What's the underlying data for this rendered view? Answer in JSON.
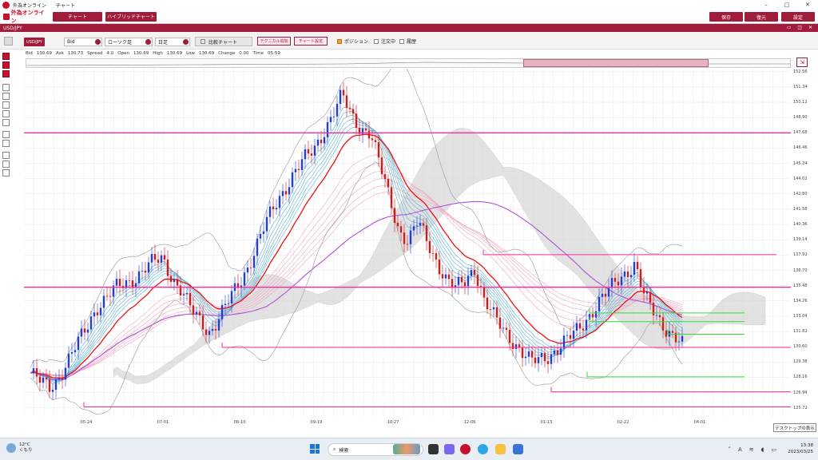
{
  "window": {
    "title_app": "外為オンライン",
    "title_page": "チャート"
  },
  "menubar": {
    "brand": "外為オンライン",
    "chart_button": "チャート",
    "hybrid_button": "ハイブリッドチャート",
    "save_button": "保存",
    "restore_button": "復元",
    "settings_button": "設定"
  },
  "panel": {
    "title": "USD/JPY"
  },
  "toolbar": {
    "symbol": "USD/JPY",
    "price_type": "Bid",
    "chart_type": "ローソク足",
    "timeframe": "日足",
    "compare_chart": "比較チャート",
    "add_technical": "テクニカル追加",
    "chart_settings": "チャート設定",
    "position_label": "ポジション",
    "position_checked": true,
    "ordering_label": "注文中",
    "history_label": "履歴"
  },
  "quote": {
    "bid_label": "Bid",
    "bid": "130.69",
    "ask_label": "Ask",
    "ask": "130.73",
    "spread_label": "Spread",
    "spread": "4.0",
    "open_label": "Open",
    "open": "130.69",
    "high_label": "High",
    "high": "130.69",
    "low_label": "Low",
    "low": "130.69",
    "change_label": "Change",
    "change": "0.00",
    "time_label": "Time",
    "time": "05:59"
  },
  "chart_data": {
    "type": "line",
    "ylim": [
      125.0,
      152.8
    ],
    "y_ticks": [
      "152.56",
      "151.34",
      "150.12",
      "148.90",
      "147.68",
      "146.46",
      "145.24",
      "144.02",
      "142.80",
      "141.58",
      "140.36",
      "139.14",
      "137.92",
      "136.70",
      "135.48",
      "134.26",
      "133.04",
      "131.82",
      "130.60",
      "129.38",
      "128.16",
      "126.94",
      "125.72"
    ],
    "x_ticks": [
      "05-24",
      "07-01",
      "08-10",
      "09-19",
      "10-27",
      "12-06",
      "01-13",
      "02-22",
      "04-01"
    ],
    "horizontal_lines": [
      {
        "y": 147.68,
        "color": "#ff2aa0"
      },
      {
        "y": 135.35,
        "color": "#ff2aa0"
      },
      {
        "y": 137.95,
        "color": "#ff2aa0"
      },
      {
        "y": 130.55,
        "color": "#ff2aa0"
      },
      {
        "y": 127.0,
        "color": "#ff2aa0"
      },
      {
        "y": 125.8,
        "color": "#ff2aa0"
      },
      {
        "y": 133.3,
        "color": "#33dd33"
      },
      {
        "y": 132.6,
        "color": "#33dd33"
      },
      {
        "y": 131.6,
        "color": "#33dd33"
      },
      {
        "y": 128.2,
        "color": "#33dd33"
      }
    ],
    "close_path": [
      128.5,
      127.8,
      127.3,
      128.2,
      129.5,
      130.8,
      132.2,
      133.8,
      134.5,
      135.2,
      135.6,
      136.1,
      136.8,
      137.3,
      137.6,
      136.2,
      135.1,
      133.5,
      132.6,
      131.8,
      133.0,
      134.2,
      135.5,
      137.0,
      138.8,
      140.5,
      142.0,
      143.4,
      144.6,
      145.5,
      146.3,
      147.8,
      149.2,
      150.6,
      149.0,
      148.1,
      147.7,
      145.0,
      142.5,
      140.0,
      139.0,
      140.5,
      139.0,
      137.5,
      136.0,
      135.2,
      135.8,
      137.0,
      134.4,
      133.0,
      132.0,
      131.2,
      130.2,
      129.3,
      129.6,
      130.0,
      130.6,
      131.2,
      132.0,
      133.0,
      134.0,
      134.8,
      135.8,
      136.6,
      137.2,
      134.5,
      133.4,
      132.4,
      131.5,
      130.7
    ],
    "colors": {
      "bull": "#1f3fd8",
      "bear": "#d41a1a",
      "ma_red": "#ee1111",
      "ma_purple": "#b050d8",
      "bollinger": "#999999",
      "cloud": "#d6d6d6"
    }
  },
  "tooltip": "デスクトップの表示",
  "taskbar": {
    "weather_temp": "12°C",
    "weather_desc": "くもり",
    "search": "検索",
    "time": "13:38",
    "date": "2023/03/25",
    "ime": "A"
  }
}
